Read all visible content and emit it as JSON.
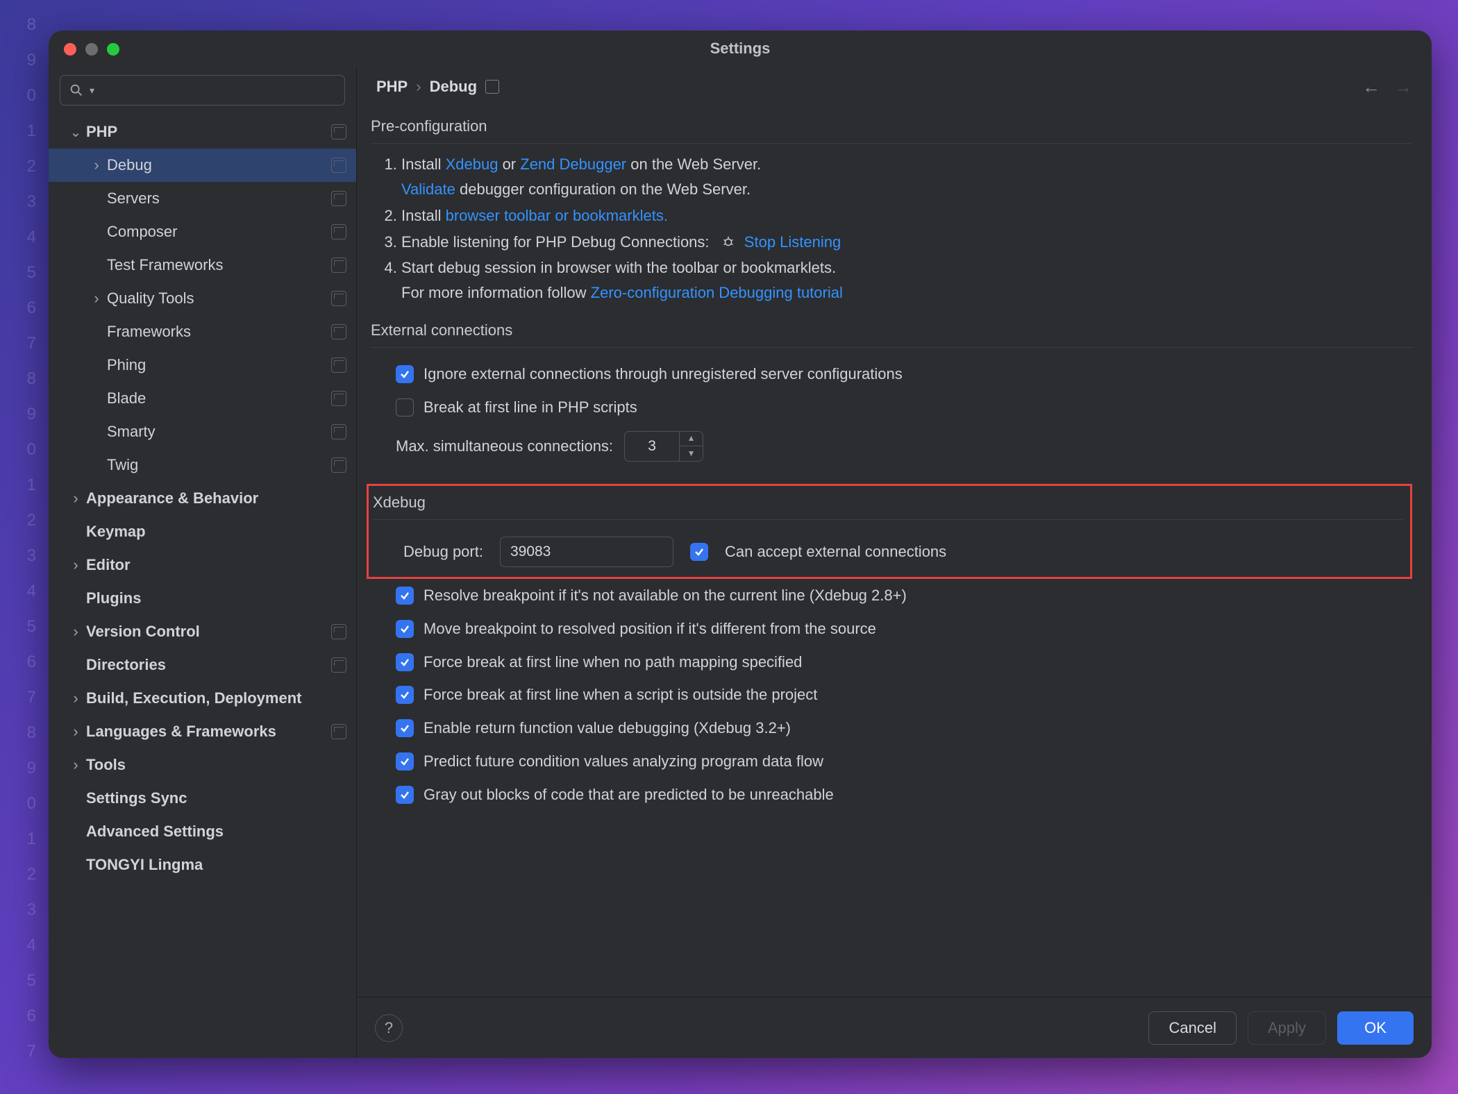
{
  "gutter_lines": [
    "8",
    "9",
    "0",
    "1",
    "2",
    "3",
    "4",
    "5",
    "6",
    "7",
    "8",
    "9",
    "0",
    "1",
    "2",
    "3",
    "4",
    "5",
    "6",
    "7",
    "8",
    "9",
    "0",
    "1",
    "2",
    "3",
    "4",
    "5",
    "6",
    "7"
  ],
  "window_title": "Settings",
  "sidebar": {
    "items": [
      {
        "level": 1,
        "label": "PHP",
        "bold": true,
        "chev": "down",
        "badge": true
      },
      {
        "level": 2,
        "label": "Debug",
        "bold": false,
        "chev": "right",
        "badge": true,
        "selected": true
      },
      {
        "level": 2,
        "label": "Servers",
        "badge": true
      },
      {
        "level": 2,
        "label": "Composer",
        "badge": true
      },
      {
        "level": 2,
        "label": "Test Frameworks",
        "badge": true
      },
      {
        "level": 2,
        "label": "Quality Tools",
        "chev": "right",
        "badge": true
      },
      {
        "level": 2,
        "label": "Frameworks",
        "badge": true
      },
      {
        "level": 2,
        "label": "Phing",
        "badge": true
      },
      {
        "level": 2,
        "label": "Blade",
        "badge": true
      },
      {
        "level": 2,
        "label": "Smarty",
        "badge": true
      },
      {
        "level": 2,
        "label": "Twig",
        "badge": true
      },
      {
        "level": 1,
        "label": "Appearance & Behavior",
        "bold": true,
        "chev": "right"
      },
      {
        "level": 1,
        "label": "Keymap",
        "bold": true
      },
      {
        "level": 1,
        "label": "Editor",
        "bold": true,
        "chev": "right"
      },
      {
        "level": 1,
        "label": "Plugins",
        "bold": true
      },
      {
        "level": 1,
        "label": "Version Control",
        "bold": true,
        "chev": "right",
        "badge": true
      },
      {
        "level": 1,
        "label": "Directories",
        "bold": true,
        "badge": true
      },
      {
        "level": 1,
        "label": "Build, Execution, Deployment",
        "bold": true,
        "chev": "right"
      },
      {
        "level": 1,
        "label": "Languages & Frameworks",
        "bold": true,
        "chev": "right",
        "badge": true
      },
      {
        "level": 1,
        "label": "Tools",
        "bold": true,
        "chev": "right"
      },
      {
        "level": 1,
        "label": "Settings Sync",
        "bold": true
      },
      {
        "level": 1,
        "label": "Advanced Settings",
        "bold": true
      },
      {
        "level": 1,
        "label": "TONGYI Lingma",
        "bold": true
      }
    ]
  },
  "breadcrumb": {
    "root": "PHP",
    "leaf": "Debug"
  },
  "preconfig": {
    "title": "Pre-configuration",
    "line1a": "Install ",
    "line1_link1": "Xdebug",
    "line1b": " or ",
    "line1_link2": "Zend Debugger",
    "line1c": " on the Web Server.",
    "line1_sub_link": "Validate",
    "line1_sub": " debugger configuration on the Web Server.",
    "line2a": "Install ",
    "line2_link": "browser toolbar or bookmarklets.",
    "line3a": "Enable listening for PHP Debug Connections:",
    "line3_link": "Stop Listening",
    "line4a": "Start debug session in browser with the toolbar or bookmarklets.",
    "line4_sub_a": "For more information follow ",
    "line4_sub_link": "Zero-configuration Debugging tutorial"
  },
  "ext": {
    "title": "External connections",
    "chk_ignore": "Ignore external connections through unregistered server configurations",
    "chk_break": "Break at first line in PHP scripts",
    "max_label": "Max. simultaneous connections:",
    "max_value": "3"
  },
  "xdebug": {
    "title": "Xdebug",
    "port_label": "Debug port:",
    "port_value": "39083",
    "chk_accept": "Can accept external connections",
    "chk_resolve": "Resolve breakpoint if it's not available on the current line (Xdebug 2.8+)",
    "chk_move": "Move breakpoint to resolved position if it's different from the source",
    "chk_force1": "Force break at first line when no path mapping specified",
    "chk_force2": "Force break at first line when a script is outside the project",
    "chk_return": "Enable return function value debugging (Xdebug 3.2+)",
    "chk_predict": "Predict future condition values analyzing program data flow",
    "chk_gray": "Gray out blocks of code that are predicted to be unreachable"
  },
  "footer": {
    "cancel": "Cancel",
    "apply": "Apply",
    "ok": "OK"
  }
}
